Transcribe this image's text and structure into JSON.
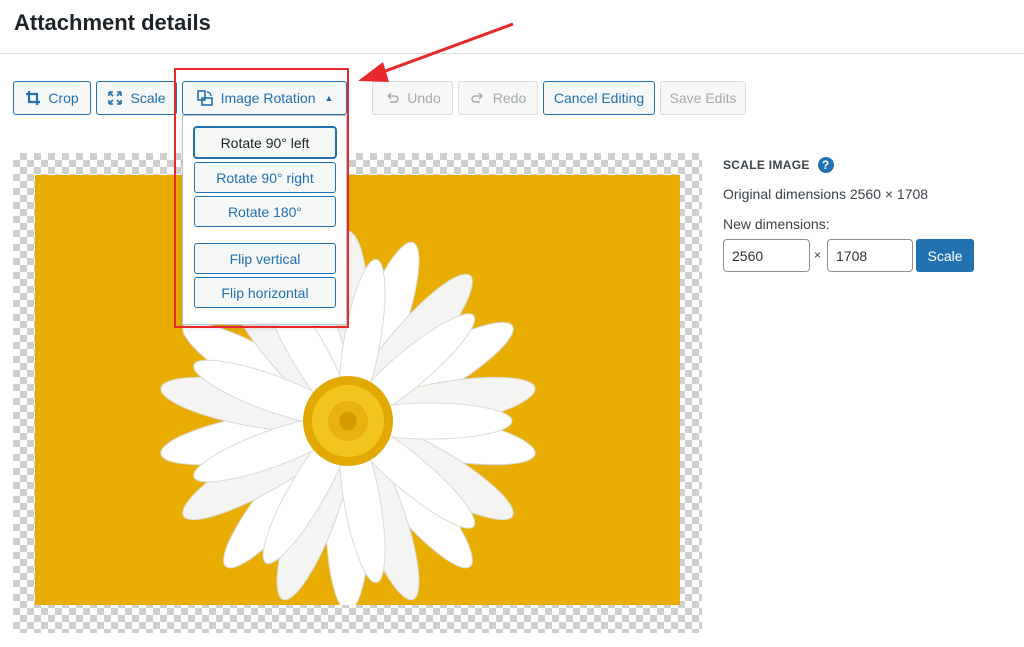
{
  "header": {
    "title": "Attachment details"
  },
  "toolbar": {
    "crop_label": "Crop",
    "scale_label": "Scale",
    "rotation_label": "Image Rotation",
    "undo_label": "Undo",
    "redo_label": "Redo",
    "cancel_label": "Cancel Editing",
    "save_label": "Save Edits"
  },
  "rotation_menu": {
    "items": [
      {
        "label": "Rotate 90° left"
      },
      {
        "label": "Rotate 90° right"
      },
      {
        "label": "Rotate 180°"
      },
      {
        "label": "Flip vertical"
      },
      {
        "label": "Flip horizontal"
      }
    ]
  },
  "scale_panel": {
    "heading": "SCALE IMAGE",
    "help_icon": "?",
    "original": "Original dimensions 2560 × 1708",
    "new_label": "New dimensions:",
    "width_value": "2560",
    "times": "×",
    "height_value": "1708",
    "button_label": "Scale"
  },
  "colors": {
    "accent": "#2271b1",
    "annotation": "#e8292b",
    "photo_background": "#e8ad00"
  },
  "icons": [
    "crop-icon",
    "scale-icon",
    "rotation-icon",
    "caret-up-icon",
    "undo-icon",
    "redo-icon",
    "help-icon"
  ]
}
